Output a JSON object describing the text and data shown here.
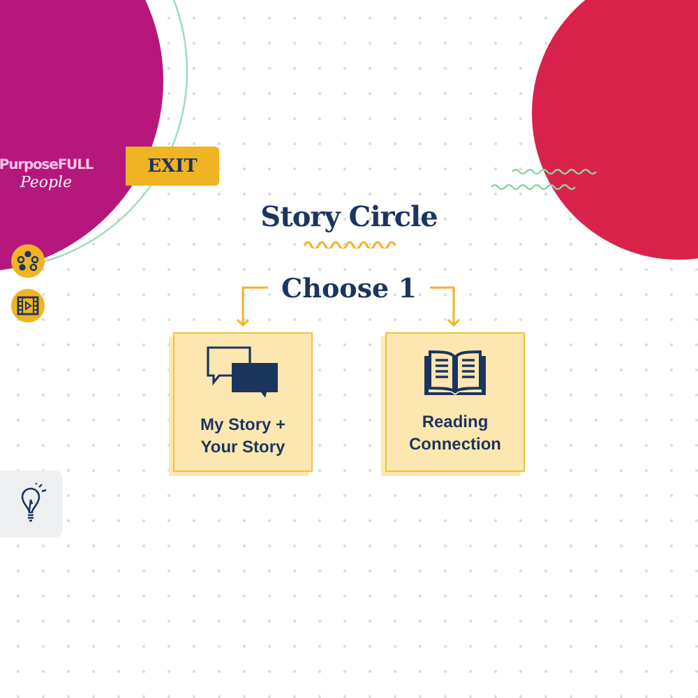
{
  "logo": {
    "line_1": "PurposeFULL",
    "line_2": "People"
  },
  "exit_button": {
    "label": "EXIT"
  },
  "side_tools": [
    {
      "kind": "network"
    },
    {
      "kind": "video"
    }
  ],
  "hint_tool": {
    "kind": "lightbulb"
  },
  "title": "Story Circle",
  "prompt": "Choose 1",
  "choices": [
    {
      "label": "My Story + Your Story",
      "kind": "chat"
    },
    {
      "label": "Reading Connection",
      "kind": "book"
    }
  ]
}
